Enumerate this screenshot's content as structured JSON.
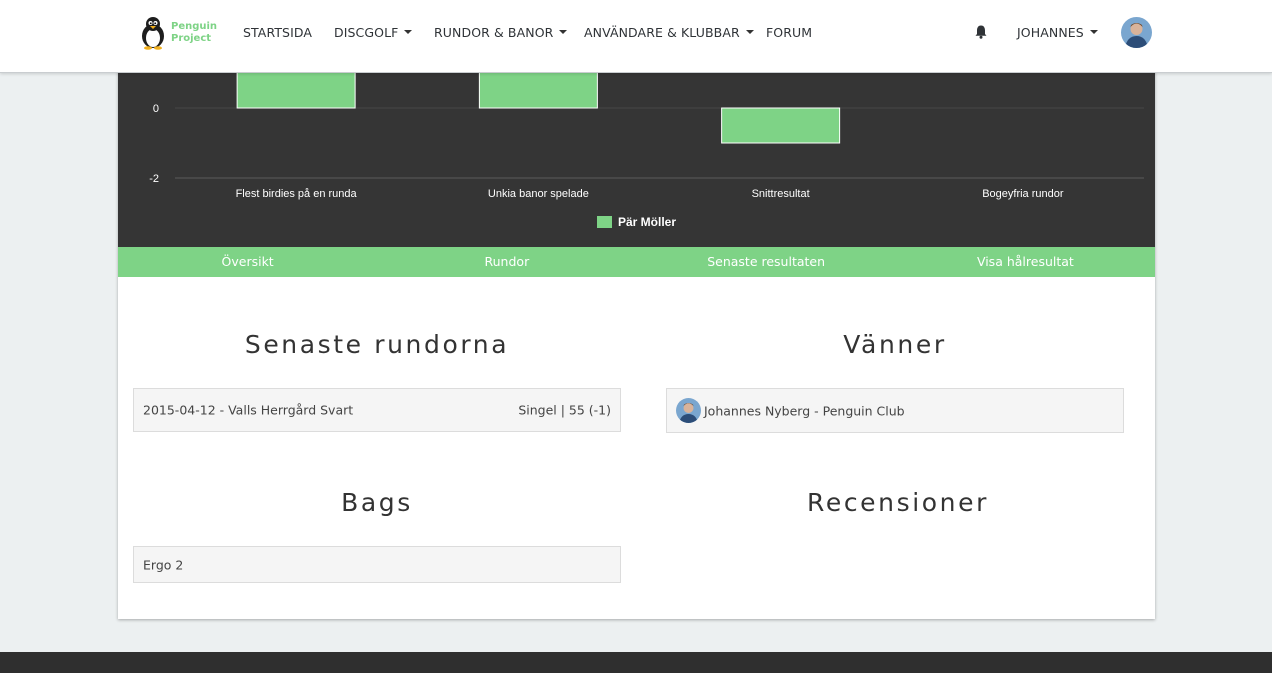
{
  "brand": {
    "line1": "Penguin",
    "line2": "Project",
    "color": "#7ed386"
  },
  "nav": {
    "items": [
      {
        "label": "STARTSIDA",
        "dropdown": false
      },
      {
        "label": "DISCGOLF",
        "dropdown": true
      },
      {
        "label": "RUNDOR & BANOR",
        "dropdown": true
      },
      {
        "label": "ANVÄNDARE & KLUBBAR",
        "dropdown": true
      },
      {
        "label": "FORUM",
        "dropdown": false
      }
    ],
    "notifications_icon": "bell-icon",
    "user": {
      "label": "JOHANNES",
      "dropdown": true
    }
  },
  "chart_data": {
    "type": "bar",
    "categories": [
      "Flest birdies på en runda",
      "Unkia banor spelade",
      "Snittresultat",
      "Bogeyfria rundor"
    ],
    "series": [
      {
        "name": "Pär Möller",
        "values": [
          2,
          2,
          -1,
          0
        ],
        "color": "#7ed386"
      }
    ],
    "y_tick_labels": [
      "0",
      "-2"
    ],
    "ylim": [
      -2,
      2
    ],
    "grid": true,
    "legend_position": "bottom",
    "title": "",
    "xlabel": "",
    "ylabel": ""
  },
  "tabs": [
    "Översikt",
    "Rundor",
    "Senaste resultaten",
    "Visa hålresultat"
  ],
  "sections": {
    "recent_rounds": {
      "title": "Senaste rundorna",
      "items": [
        {
          "left": "2015-04-12 - Valls Herrgård Svart",
          "right": "Singel | 55 (-1)"
        }
      ]
    },
    "friends": {
      "title": "Vänner",
      "items": [
        {
          "name": "Johannes Nyberg - Penguin Club"
        }
      ]
    },
    "bags": {
      "title": "Bags",
      "items": [
        {
          "name": "Ergo 2"
        }
      ]
    },
    "reviews": {
      "title": "Recensioner",
      "items": []
    }
  },
  "colors": {
    "accent": "#7ed386",
    "chart_bg": "#353535",
    "footer": "#2f2f2f",
    "page_bg": "#ecf0f1"
  }
}
